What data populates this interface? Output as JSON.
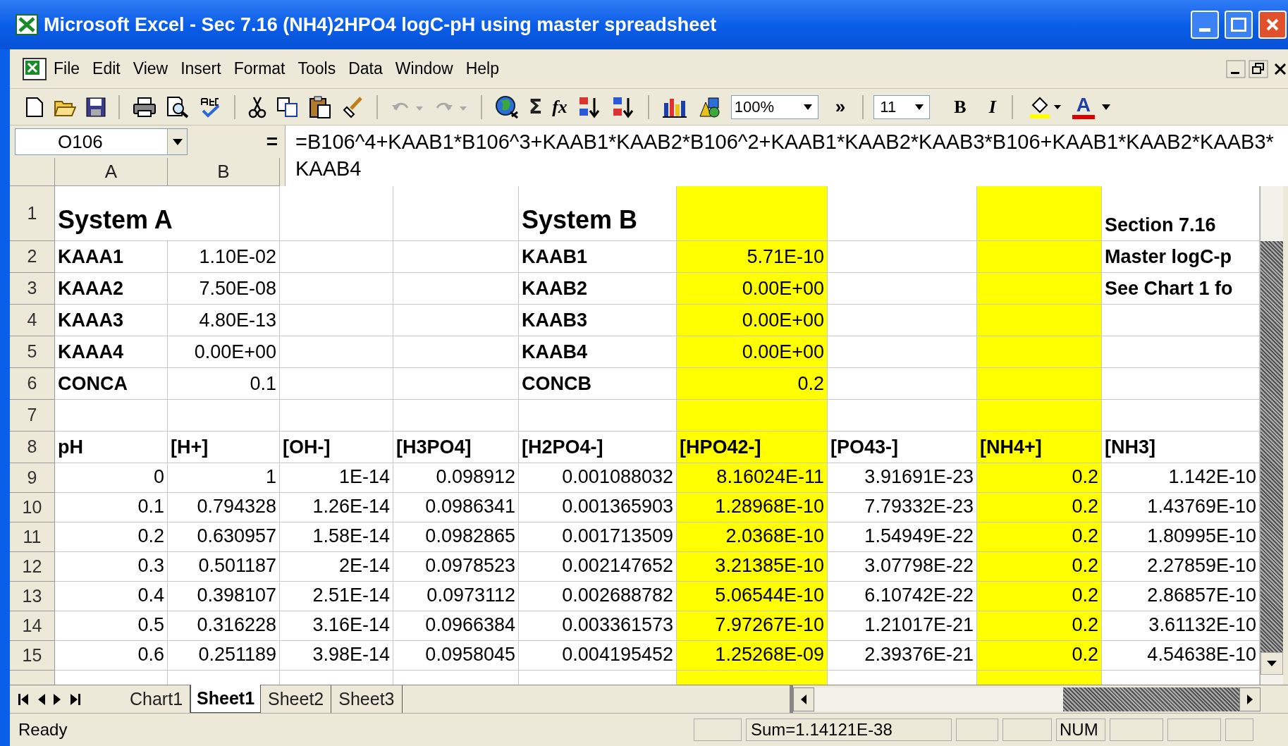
{
  "window": {
    "title": "Microsoft Excel - Sec 7.16 (NH4)2HPO4 logC-pH using master spreadsheet"
  },
  "menu": [
    "File",
    "Edit",
    "View",
    "Insert",
    "Format",
    "Tools",
    "Data",
    "Window",
    "Help"
  ],
  "toolbar": {
    "sum": "Σ",
    "function": "fx",
    "zoom": "100%",
    "more": "»",
    "font_size": "11",
    "bold": "B",
    "italic": "I",
    "font_color": "A"
  },
  "formula_bar": {
    "name_box": "O106",
    "sign": "=",
    "formula": "=B106^4+KAAB1*B106^3+KAAB1*KAAB2*B106^2+KAAB1*KAAB2*KAAB3*B106+KAAB1*KAAB2*KAAB3*KAAB4"
  },
  "columns": [
    {
      "header": "A",
      "highlighted": false
    },
    {
      "header": "B",
      "highlighted": false
    },
    {
      "highlighted": false
    },
    {
      "highlighted": false
    },
    {
      "highlighted": false
    },
    {
      "highlighted": true
    },
    {
      "highlighted": false
    },
    {
      "highlighted": true
    },
    {
      "highlighted": false
    }
  ],
  "rows": [
    {
      "number": "1",
      "cells": [
        {
          "text": "System A",
          "kind": "title"
        },
        null,
        null,
        null,
        {
          "text": "System B",
          "kind": "title"
        },
        null,
        null,
        null,
        {
          "text": "Section 7.16",
          "kind": "label"
        }
      ]
    },
    {
      "number": "2",
      "cells": [
        {
          "text": "KAAA1",
          "kind": "label"
        },
        {
          "text": "1.10E-02",
          "kind": "number"
        },
        null,
        null,
        {
          "text": "KAAB1",
          "kind": "label"
        },
        {
          "text": "5.71E-10",
          "kind": "number"
        },
        null,
        null,
        {
          "text": "Master logC-p",
          "kind": "label"
        }
      ]
    },
    {
      "number": "3",
      "cells": [
        {
          "text": "KAAA2",
          "kind": "label"
        },
        {
          "text": "7.50E-08",
          "kind": "number"
        },
        null,
        null,
        {
          "text": "KAAB2",
          "kind": "label"
        },
        {
          "text": "0.00E+00",
          "kind": "number"
        },
        null,
        null,
        {
          "text": "See Chart 1 fo",
          "kind": "label"
        }
      ]
    },
    {
      "number": "4",
      "cells": [
        {
          "text": "KAAA3",
          "kind": "label"
        },
        {
          "text": "4.80E-13",
          "kind": "number"
        },
        null,
        null,
        {
          "text": "KAAB3",
          "kind": "label"
        },
        {
          "text": "0.00E+00",
          "kind": "number"
        },
        null,
        null,
        null
      ]
    },
    {
      "number": "5",
      "cells": [
        {
          "text": "KAAA4",
          "kind": "label"
        },
        {
          "text": "0.00E+00",
          "kind": "number"
        },
        null,
        null,
        {
          "text": "KAAB4",
          "kind": "label"
        },
        {
          "text": "0.00E+00",
          "kind": "number"
        },
        null,
        null,
        null
      ]
    },
    {
      "number": "6",
      "cells": [
        {
          "text": "CONCA",
          "kind": "label"
        },
        {
          "text": "0.1",
          "kind": "number"
        },
        null,
        null,
        {
          "text": "CONCB",
          "kind": "label"
        },
        {
          "text": "0.2",
          "kind": "number"
        },
        null,
        null,
        null
      ]
    },
    {
      "number": "7",
      "cells": [
        null,
        null,
        null,
        null,
        null,
        null,
        null,
        null,
        null
      ]
    },
    {
      "number": "8",
      "cells": [
        {
          "text": "pH",
          "kind": "label"
        },
        {
          "text": "[H+]",
          "kind": "label"
        },
        {
          "text": "[OH-]",
          "kind": "label"
        },
        {
          "text": "[H3PO4]",
          "kind": "label"
        },
        {
          "text": "[H2PO4-]",
          "kind": "label"
        },
        {
          "text": "[HPO42-]",
          "kind": "label"
        },
        {
          "text": "[PO43-]",
          "kind": "label"
        },
        {
          "text": "[NH4+]",
          "kind": "label"
        },
        {
          "text": "[NH3]",
          "kind": "label"
        }
      ]
    },
    {
      "number": "9",
      "cells": [
        {
          "text": "0",
          "kind": "number"
        },
        {
          "text": "1",
          "kind": "number"
        },
        {
          "text": "1E-14",
          "kind": "number"
        },
        {
          "text": "0.098912",
          "kind": "number"
        },
        {
          "text": "0.001088032",
          "kind": "number"
        },
        {
          "text": "8.16024E-11",
          "kind": "number"
        },
        {
          "text": "3.91691E-23",
          "kind": "number"
        },
        {
          "text": "0.2",
          "kind": "number"
        },
        {
          "text": "1.142E-10",
          "kind": "number"
        }
      ]
    },
    {
      "number": "10",
      "cells": [
        {
          "text": "0.1",
          "kind": "number"
        },
        {
          "text": "0.794328",
          "kind": "number"
        },
        {
          "text": "1.26E-14",
          "kind": "number"
        },
        {
          "text": "0.0986341",
          "kind": "number"
        },
        {
          "text": "0.001365903",
          "kind": "number"
        },
        {
          "text": "1.28968E-10",
          "kind": "number"
        },
        {
          "text": "7.79332E-23",
          "kind": "number"
        },
        {
          "text": "0.2",
          "kind": "number"
        },
        {
          "text": "1.43769E-10",
          "kind": "number"
        }
      ]
    },
    {
      "number": "11",
      "cells": [
        {
          "text": "0.2",
          "kind": "number"
        },
        {
          "text": "0.630957",
          "kind": "number"
        },
        {
          "text": "1.58E-14",
          "kind": "number"
        },
        {
          "text": "0.0982865",
          "kind": "number"
        },
        {
          "text": "0.001713509",
          "kind": "number"
        },
        {
          "text": "2.0368E-10",
          "kind": "number"
        },
        {
          "text": "1.54949E-22",
          "kind": "number"
        },
        {
          "text": "0.2",
          "kind": "number"
        },
        {
          "text": "1.80995E-10",
          "kind": "number"
        }
      ]
    },
    {
      "number": "12",
      "cells": [
        {
          "text": "0.3",
          "kind": "number"
        },
        {
          "text": "0.501187",
          "kind": "number"
        },
        {
          "text": "2E-14",
          "kind": "number"
        },
        {
          "text": "0.0978523",
          "kind": "number"
        },
        {
          "text": "0.002147652",
          "kind": "number"
        },
        {
          "text": "3.21385E-10",
          "kind": "number"
        },
        {
          "text": "3.07798E-22",
          "kind": "number"
        },
        {
          "text": "0.2",
          "kind": "number"
        },
        {
          "text": "2.27859E-10",
          "kind": "number"
        }
      ]
    },
    {
      "number": "13",
      "cells": [
        {
          "text": "0.4",
          "kind": "number"
        },
        {
          "text": "0.398107",
          "kind": "number"
        },
        {
          "text": "2.51E-14",
          "kind": "number"
        },
        {
          "text": "0.0973112",
          "kind": "number"
        },
        {
          "text": "0.002688782",
          "kind": "number"
        },
        {
          "text": "5.06544E-10",
          "kind": "number"
        },
        {
          "text": "6.10742E-22",
          "kind": "number"
        },
        {
          "text": "0.2",
          "kind": "number"
        },
        {
          "text": "2.86857E-10",
          "kind": "number"
        }
      ]
    },
    {
      "number": "14",
      "cells": [
        {
          "text": "0.5",
          "kind": "number"
        },
        {
          "text": "0.316228",
          "kind": "number"
        },
        {
          "text": "3.16E-14",
          "kind": "number"
        },
        {
          "text": "0.0966384",
          "kind": "number"
        },
        {
          "text": "0.003361573",
          "kind": "number"
        },
        {
          "text": "7.97267E-10",
          "kind": "number"
        },
        {
          "text": "1.21017E-21",
          "kind": "number"
        },
        {
          "text": "0.2",
          "kind": "number"
        },
        {
          "text": "3.61132E-10",
          "kind": "number"
        }
      ]
    },
    {
      "number": "15",
      "cells": [
        {
          "text": "0.6",
          "kind": "number"
        },
        {
          "text": "0.251189",
          "kind": "number"
        },
        {
          "text": "3.98E-14",
          "kind": "number"
        },
        {
          "text": "0.0958045",
          "kind": "number"
        },
        {
          "text": "0.004195452",
          "kind": "number"
        },
        {
          "text": "1.25268E-09",
          "kind": "number"
        },
        {
          "text": "2.39376E-21",
          "kind": "number"
        },
        {
          "text": "0.2",
          "kind": "number"
        },
        {
          "text": "4.54638E-10",
          "kind": "number"
        }
      ]
    }
  ],
  "sheet_tabs": [
    {
      "label": "Chart1",
      "selected": false
    },
    {
      "label": "Sheet1",
      "selected": true
    },
    {
      "label": "Sheet2",
      "selected": false
    },
    {
      "label": "Sheet3",
      "selected": false
    }
  ],
  "status_bar": {
    "mode": "Ready",
    "sum": "Sum=1.14121E-38",
    "num_lock": "NUM"
  }
}
